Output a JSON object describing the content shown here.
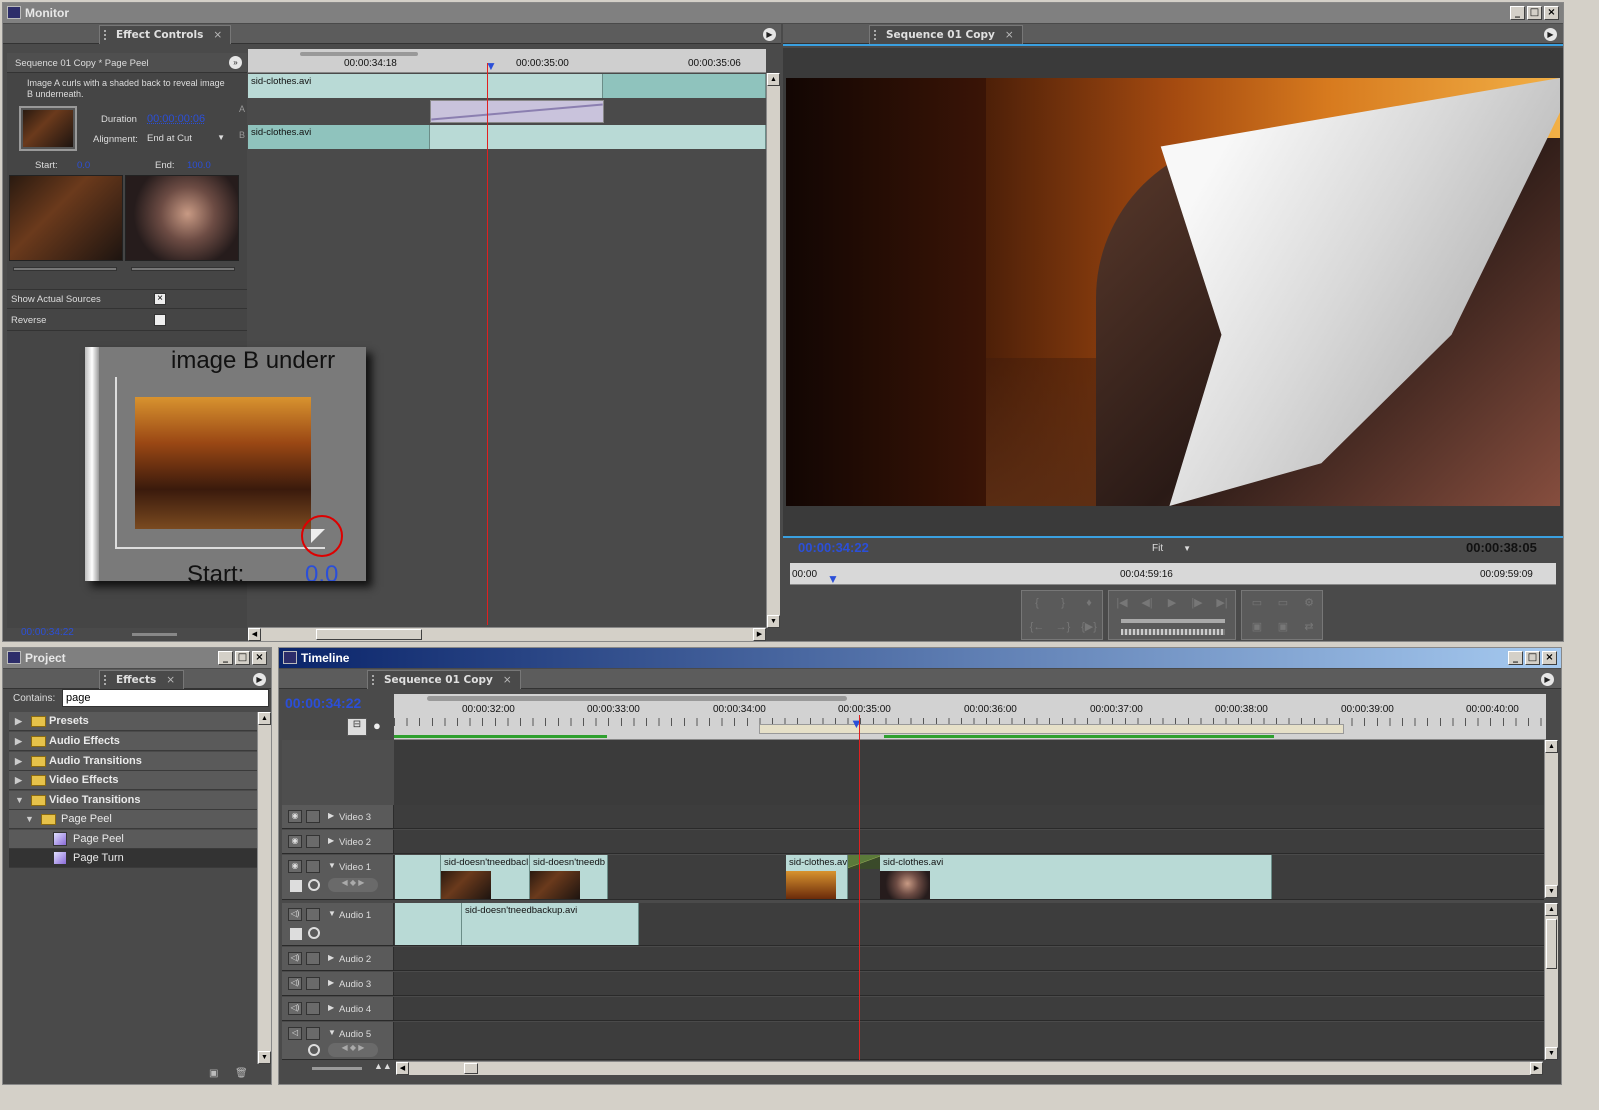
{
  "monitor": {
    "title": "Monitor",
    "effect_tab": "Effect Controls",
    "program_tab": "Sequence 01 Copy",
    "effect": {
      "header": "Sequence 01 Copy * Page Peel",
      "description": "Image A curls with a shaded back to reveal image B underneath.",
      "duration_label": "Duration",
      "duration_value": "00:00:00:06",
      "alignment_label": "Alignment:",
      "alignment_value": "End at Cut",
      "start_label": "Start:",
      "start_value": "0.0",
      "end_label": "End:",
      "end_value": "100.0",
      "show_sources_label": "Show Actual Sources",
      "show_sources_checked": true,
      "reverse_label": "Reverse",
      "reverse_checked": false,
      "zoom_text": "image B underr",
      "zoom_start_label": "Start:",
      "zoom_start_value": "0.0",
      "timecode": "00:00:34:22",
      "a_label": "A",
      "b_label": "B"
    },
    "mini_ruler": [
      "00:00:34:18",
      "00:00:35:00",
      "00:00:35:06"
    ],
    "mini_clip_a": "sid-clothes.avi",
    "mini_clip_b": "sid-clothes.avi",
    "program": {
      "current_time": "00:00:34:22",
      "duration": "00:00:38:05",
      "fit_label": "Fit",
      "ruler": [
        "00:00",
        "00:04:59:16",
        "00:09:59:09"
      ]
    }
  },
  "project": {
    "title": "Project",
    "tab": "Effects",
    "contains_label": "Contains:",
    "search_value": "page",
    "items": [
      {
        "label": "Presets",
        "level": 0,
        "expanded": false
      },
      {
        "label": "Audio Effects",
        "level": 0,
        "expanded": false
      },
      {
        "label": "Audio Transitions",
        "level": 0,
        "expanded": false
      },
      {
        "label": "Video Effects",
        "level": 0,
        "expanded": false
      },
      {
        "label": "Video Transitions",
        "level": 0,
        "expanded": true
      },
      {
        "label": "Page Peel",
        "level": 1,
        "expanded": true
      },
      {
        "label": "Page Peel",
        "level": 2,
        "expanded": false
      },
      {
        "label": "Page Turn",
        "level": 2,
        "expanded": false
      }
    ]
  },
  "timeline": {
    "title": "Timeline",
    "tab": "Sequence 01 Copy",
    "timecode": "00:00:34:22",
    "ruler": [
      "00:00:32:00",
      "00:00:33:00",
      "00:00:34:00",
      "00:00:35:00",
      "00:00:36:00",
      "00:00:37:00",
      "00:00:38:00",
      "00:00:39:00",
      "00:00:40:00"
    ],
    "tracks": {
      "v3": "Video 3",
      "v2": "Video 2",
      "v1": "Video 1",
      "a1": "Audio 1",
      "a2": "Audio 2",
      "a3": "Audio 3",
      "a4": "Audio 4",
      "a5": "Audio 5"
    },
    "clips": {
      "v1_a": "sid-doesn'tneedbacl",
      "v1_b": "sid-doesn'tneedb",
      "v1_c": "sid-clothes.av",
      "v1_d": "sid-clothes.avi",
      "a1_a": "sid-doesn'tneedbackup.avi"
    }
  },
  "colors": {
    "timecode": "#2b4fd8",
    "clip": "#b9dad6",
    "playhead": "#e02020",
    "active_title": "#0a246a"
  }
}
